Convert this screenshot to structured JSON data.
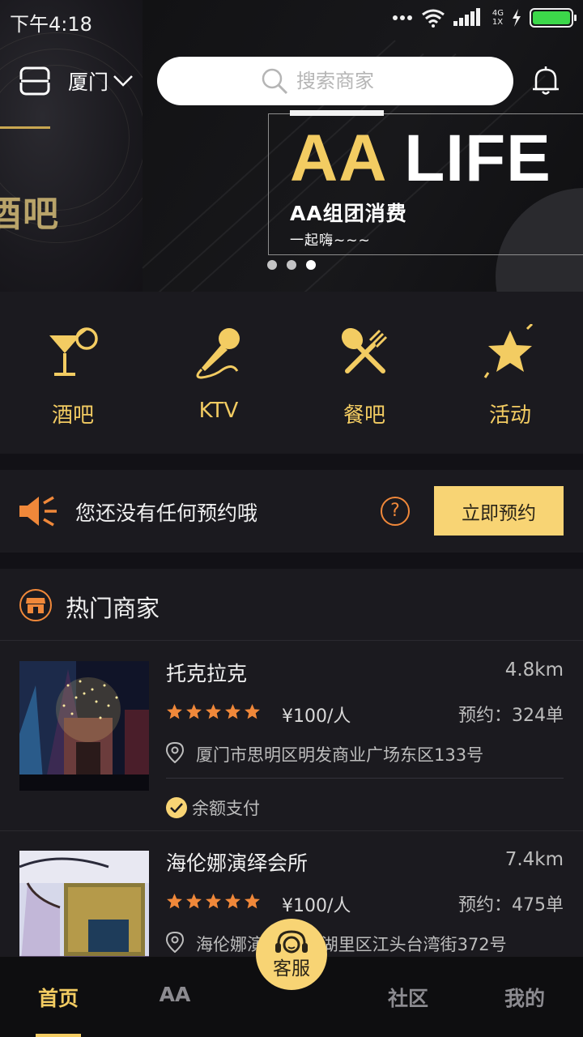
{
  "status_bar": {
    "time": "下午4:18",
    "network_top": "4G",
    "network_bottom": "1X"
  },
  "header": {
    "city": "厦门",
    "search_placeholder": "搜索商家"
  },
  "banner": {
    "title_gold": "AA",
    "title_white": "LIFE",
    "subtitle": "AA组团消费",
    "tagline": "一起嗨~~~",
    "side_text": "酒吧",
    "slides": 3,
    "active_slide": 3
  },
  "categories": [
    {
      "label": "酒吧",
      "icon": "cocktail-icon"
    },
    {
      "label": "KTV",
      "icon": "microphone-icon"
    },
    {
      "label": "餐吧",
      "icon": "dining-icon"
    },
    {
      "label": "活动",
      "icon": "star-icon"
    }
  ],
  "reservation": {
    "text": "您还没有任何预约哦",
    "help": "?",
    "button": "立即预约"
  },
  "hot": {
    "title": "热门商家",
    "merchants": [
      {
        "name": "托克拉克",
        "distance": "4.8km",
        "rating": 5,
        "price": "¥100/人",
        "orders": "预约：324单",
        "address": "厦门市思明区明发商业广场东区133号",
        "payment": "余额支付"
      },
      {
        "name": "海伦娜演绎会所",
        "distance": "7.4km",
        "rating": 5,
        "price": "¥100/人",
        "orders": "预约：475单",
        "address": "海伦娜演绎会所-湖里区江头台湾街372号"
      }
    ]
  },
  "nav": {
    "home": "首页",
    "aa": "AA",
    "service": "客服",
    "community": "社区",
    "mine": "我的"
  },
  "colors": {
    "accent": "#f3cc62",
    "button": "#f8d474",
    "orange": "#f0883a",
    "background": "#121116",
    "card": "#1b1a1f"
  }
}
